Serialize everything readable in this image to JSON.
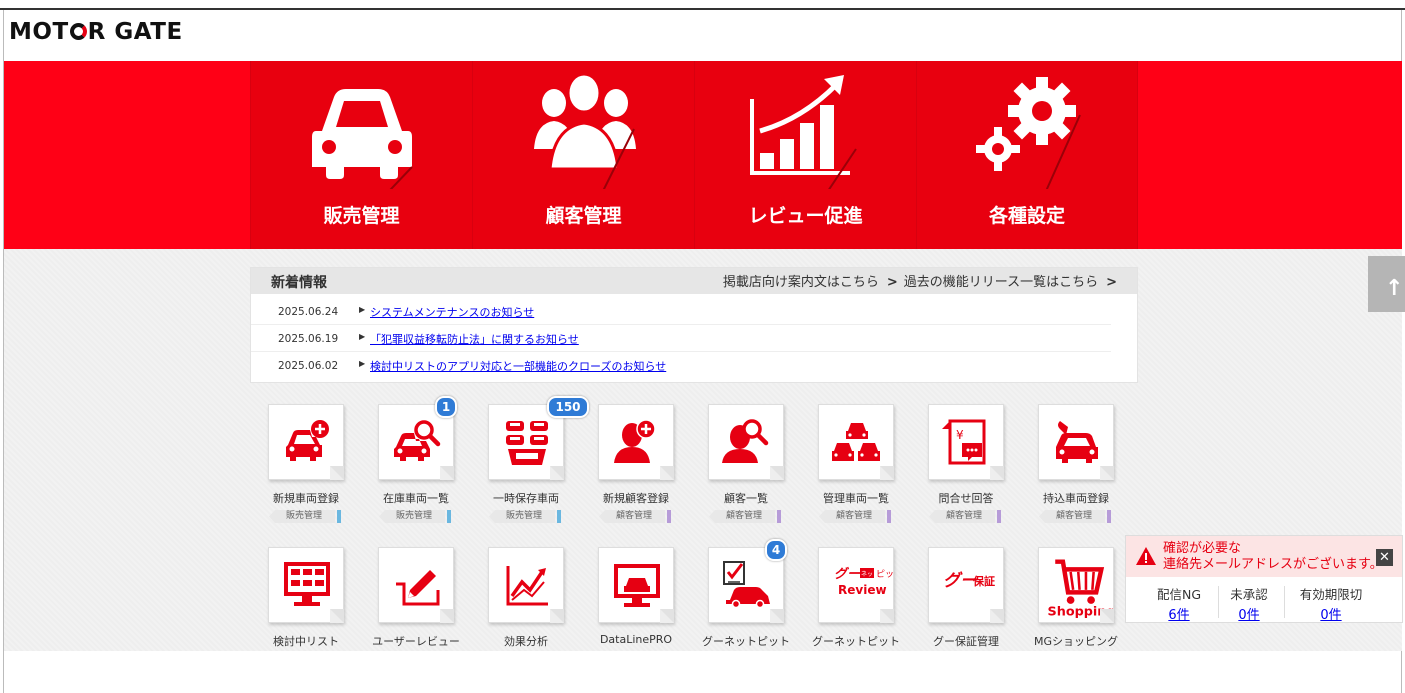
{
  "brand": {
    "logo_text_1": "MOT",
    "logo_text_2": "R GATE"
  },
  "colors": {
    "accent": "#e60012",
    "badge": "#2f7bd6",
    "sales_tag": "#6ab7e0",
    "customer_tag": "#b69bd8"
  },
  "main_nav": [
    {
      "label": "販売管理",
      "icon": "car-icon"
    },
    {
      "label": "顧客管理",
      "icon": "people-icon"
    },
    {
      "label": "レビュー促進",
      "icon": "growth-chart-icon"
    },
    {
      "label": "各種設定",
      "icon": "gears-icon"
    }
  ],
  "news": {
    "title": "新着情報",
    "link_guide": "掲載店向け案内文はこちら",
    "link_releases": "過去の機能リリース一覧はこちら",
    "items": [
      {
        "date": "2025.06.24",
        "text": "システムメンテナンスのお知らせ"
      },
      {
        "date": "2025.06.19",
        "text": "「犯罪収益移転防止法」に関するお知らせ"
      },
      {
        "date": "2025.06.02",
        "text": "検討中リストのアプリ対応と一部機能のクローズのお知らせ"
      }
    ]
  },
  "tiles_row1": [
    {
      "name": "新規車両登録",
      "category": "販売管理",
      "badge": ""
    },
    {
      "name": "在庫車両一覧",
      "category": "販売管理",
      "badge": "1"
    },
    {
      "name": "一時保存車両",
      "category": "販売管理",
      "badge": "150"
    },
    {
      "name": "新規顧客登録",
      "category": "顧客管理",
      "badge": ""
    },
    {
      "name": "顧客一覧",
      "category": "顧客管理",
      "badge": ""
    },
    {
      "name": "管理車両一覧",
      "category": "顧客管理",
      "badge": ""
    },
    {
      "name": "問合せ回答",
      "category": "顧客管理",
      "badge": ""
    },
    {
      "name": "持込車両登録",
      "category": "顧客管理",
      "badge": ""
    }
  ],
  "tiles_row2": [
    {
      "name": "検討中リスト",
      "badge": ""
    },
    {
      "name": "ユーザーレビュー",
      "badge": ""
    },
    {
      "name": "効果分析",
      "badge": ""
    },
    {
      "name": "DataLinePRO",
      "badge": ""
    },
    {
      "name": "グーネットピット",
      "badge": "4"
    },
    {
      "name": "グーネットピット",
      "badge": ""
    },
    {
      "name": "グー保証管理",
      "badge": ""
    },
    {
      "name": "MGショッピング",
      "badge": ""
    }
  ],
  "tile_icon_text": {
    "goo_pit_1": "グー",
    "goo_pit_2": "ネット",
    "goo_pit_3": "ピット",
    "goo_pit_review": "Review",
    "goo_hosho_1": "グー",
    "goo_hosho_2": "保証",
    "shopping": "Shopping"
  },
  "alert": {
    "line1": "確認が必要な",
    "line2": "連絡先メールアドレスがございます。",
    "cols": [
      {
        "label": "配信NG",
        "value": "6件"
      },
      {
        "label": "未承認",
        "value": "0件"
      },
      {
        "label": "有効期限切",
        "value": "0件"
      }
    ]
  }
}
